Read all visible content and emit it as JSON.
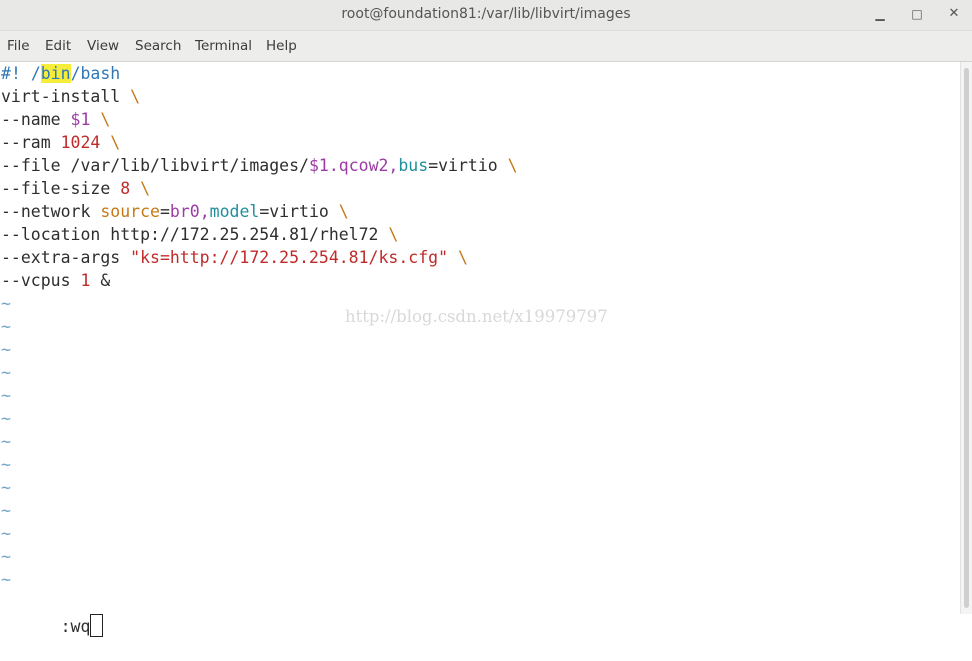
{
  "window": {
    "title": "root@foundation81:/var/lib/libvirt/images",
    "minimize_glyph": "▁",
    "maximize_glyph": "□",
    "close_glyph": "✕"
  },
  "menu": {
    "items": [
      "File",
      "Edit",
      "View",
      "Search",
      "Terminal",
      "Help"
    ]
  },
  "editor": {
    "lines": [
      {
        "tokens": [
          {
            "t": "#",
            "c": "c-blue"
          },
          {
            "t": "! ",
            "c": "c-blue"
          },
          {
            "t": "/",
            "c": "c-blue"
          },
          {
            "t": "bin",
            "c": "c-blue hl"
          },
          {
            "t": "/bash",
            "c": "c-blue"
          }
        ]
      },
      {
        "tokens": [
          {
            "t": "virt-install ",
            "c": ""
          },
          {
            "t": "\\",
            "c": "c-orange"
          }
        ]
      },
      {
        "tokens": [
          {
            "t": "--name ",
            "c": ""
          },
          {
            "t": "$1",
            "c": "c-purple"
          },
          {
            "t": " ",
            "c": ""
          },
          {
            "t": "\\",
            "c": "c-orange"
          }
        ]
      },
      {
        "tokens": [
          {
            "t": "--ram ",
            "c": ""
          },
          {
            "t": "1024",
            "c": "c-red"
          },
          {
            "t": " ",
            "c": ""
          },
          {
            "t": "\\",
            "c": "c-orange"
          }
        ]
      },
      {
        "tokens": [
          {
            "t": "--file /var/lib/libvirt/images/",
            "c": ""
          },
          {
            "t": "$1",
            "c": "c-purple"
          },
          {
            "t": ".qcow2,",
            "c": "c-purple"
          },
          {
            "t": "bus",
            "c": "c-teal"
          },
          {
            "t": "=virtio ",
            "c": ""
          },
          {
            "t": "\\",
            "c": "c-orange"
          }
        ]
      },
      {
        "tokens": [
          {
            "t": "--file-size ",
            "c": ""
          },
          {
            "t": "8",
            "c": "c-red"
          },
          {
            "t": " ",
            "c": ""
          },
          {
            "t": "\\",
            "c": "c-orange"
          }
        ]
      },
      {
        "tokens": [
          {
            "t": "--network ",
            "c": ""
          },
          {
            "t": "source",
            "c": "c-orange"
          },
          {
            "t": "=",
            "c": ""
          },
          {
            "t": "br0,",
            "c": "c-purple"
          },
          {
            "t": "model",
            "c": "c-teal"
          },
          {
            "t": "=virtio ",
            "c": ""
          },
          {
            "t": "\\",
            "c": "c-orange"
          }
        ]
      },
      {
        "tokens": [
          {
            "t": "--location http://172.25.254.81/rhel72 ",
            "c": ""
          },
          {
            "t": "\\",
            "c": "c-orange"
          }
        ]
      },
      {
        "tokens": [
          {
            "t": "--extra-args ",
            "c": ""
          },
          {
            "t": "\"ks=http://172.25.254.81/ks.cfg\"",
            "c": "c-red"
          },
          {
            "t": " ",
            "c": ""
          },
          {
            "t": "\\",
            "c": "c-orange"
          }
        ]
      },
      {
        "tokens": [
          {
            "t": "--vcpus ",
            "c": ""
          },
          {
            "t": "1",
            "c": "c-red"
          },
          {
            "t": " &",
            "c": ""
          }
        ]
      }
    ],
    "tilde_count": 13,
    "tilde_char": "~",
    "command_line": ":wq"
  },
  "watermark": "http://blog.csdn.net/x19979797"
}
